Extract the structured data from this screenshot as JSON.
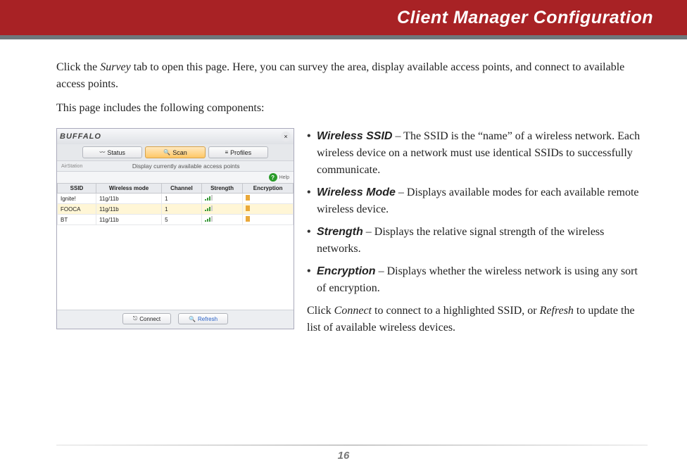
{
  "header": {
    "title": "Client Manager Configuration"
  },
  "intro": {
    "p1a": "Click the ",
    "p1_em": "Survey",
    "p1b": " tab to open this page. Here, you can survey the area, display available access points, and connect to available access points.",
    "p2": "This page includes the following components:"
  },
  "screenshot": {
    "brand": "BUFFALO",
    "tabs": {
      "status": "Status",
      "scan": "Scan",
      "profiles": "Profiles"
    },
    "left_tag": "AirStation",
    "subtitle": "Display currently available access points",
    "help_icon": "?",
    "help_label": "Help",
    "close": "×",
    "grid": {
      "headers": {
        "ssid": "SSID",
        "mode": "Wireless mode",
        "channel": "Channel",
        "strength": "Strength",
        "encryption": "Encryption"
      },
      "rows": [
        {
          "ssid": "Ignite!",
          "mode": "11g/11b",
          "channel": "1"
        },
        {
          "ssid": "FOOCA",
          "mode": "11g/11b",
          "channel": "1"
        },
        {
          "ssid": "BT",
          "mode": "11g/11b",
          "channel": "5"
        }
      ]
    },
    "buttons": {
      "connect": "Connect",
      "refresh": "Refresh"
    }
  },
  "defs": [
    {
      "term": "Wireless SSID",
      "text": " – The SSID is the “name” of a wireless network. Each wireless device on a network must use identical SSIDs to successfully communicate."
    },
    {
      "term": "Wireless Mode",
      "text": " – Displays available modes for each available remote wireless device."
    },
    {
      "term": "Strength",
      "text": " – Displays the relative signal strength of the wireless networks."
    },
    {
      "term": "Encryption",
      "text": " – Displays whether the wireless network is using any sort of encryption."
    }
  ],
  "closing": {
    "a": "Click ",
    "em1": "Connect",
    "b": " to connect to a highlighted SSID, or ",
    "em2": "Refresh",
    "c": " to update the list of available wireless devices."
  },
  "page_number": "16"
}
